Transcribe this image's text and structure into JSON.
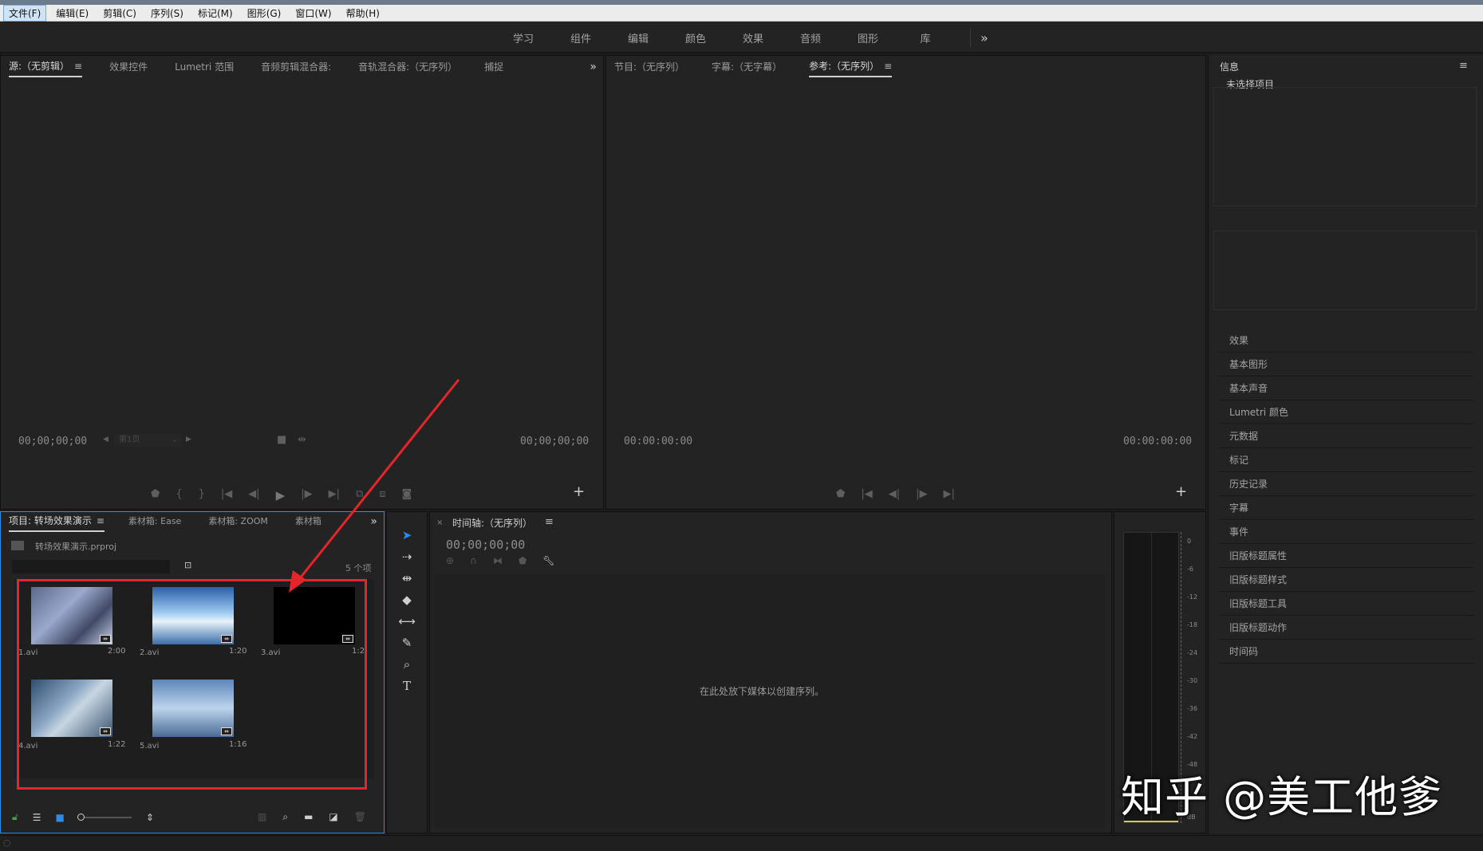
{
  "menubar": {
    "items": [
      "文件(F)",
      "编辑(E)",
      "剪辑(C)",
      "序列(S)",
      "标记(M)",
      "图形(G)",
      "窗口(W)",
      "帮助(H)"
    ]
  },
  "workspace": {
    "tabs": [
      "学习",
      "组件",
      "编辑",
      "颜色",
      "效果",
      "音频",
      "图形",
      "库"
    ],
    "more": "»"
  },
  "source_panel": {
    "tabs": [
      "源:（无剪辑）",
      "效果控件",
      "Lumetri 范围",
      "音频剪辑混合器:",
      "音轨混合器:（无序列）",
      "捕捉"
    ],
    "tc_left": "00;00;00;00",
    "tc_right": "00;00;00;00",
    "page_select": "第1页"
  },
  "program_panel": {
    "tabs": [
      "节目:（无序列）",
      "字幕:（无字幕）",
      "参考:（无序列）"
    ],
    "tc_left": "00:00:00:00",
    "tc_right": "00:00:00:00"
  },
  "info_panel": {
    "title": "信息",
    "no_selection": "未选择项目",
    "items": [
      "效果",
      "基本图形",
      "基本声音",
      "Lumetri 颜色",
      "元数据",
      "标记",
      "历史记录",
      "字幕",
      "事件",
      "旧版标题属性",
      "旧版标题样式",
      "旧版标题工具",
      "旧版标题动作",
      "时间码"
    ]
  },
  "project_panel": {
    "tabs": [
      "项目: 转场效果演示",
      "素材箱: Ease",
      "素材箱: ZOOM",
      "素材箱"
    ],
    "file": "转场效果演示.prproj",
    "count": "5 个项",
    "clips": [
      {
        "name": "1.avi",
        "duration": "2:00"
      },
      {
        "name": "2.avi",
        "duration": "1:20"
      },
      {
        "name": "3.avi",
        "duration": "1:2"
      },
      {
        "name": "4.avi",
        "duration": "1:22"
      },
      {
        "name": "5.avi",
        "duration": "1:16"
      }
    ]
  },
  "timeline_panel": {
    "tab": "时间轴:（无序列）",
    "tc": "00;00;00;00",
    "hint": "在此处放下媒体以创建序列。"
  },
  "meter": {
    "labels": [
      "0",
      "-6",
      "-12",
      "-18",
      "-24",
      "-30",
      "-36",
      "-42",
      "-48",
      "dB"
    ]
  },
  "watermark": "知乎 @美工他爹",
  "colors": {
    "annotation_red": "#e3262a",
    "selection_blue": "#2d8ceb"
  }
}
